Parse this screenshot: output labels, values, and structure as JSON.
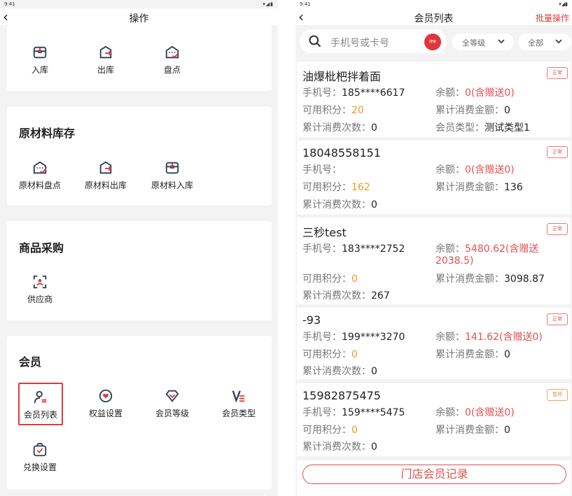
{
  "left": {
    "statusbar": {
      "time": "9:41",
      "icons": "▾◢▮"
    },
    "header": {
      "back": "‹",
      "title": "操作"
    },
    "top_section": {
      "items": [
        {
          "label": "入库",
          "icon": "inbox-in-icon"
        },
        {
          "label": "出库",
          "icon": "box-out-icon"
        },
        {
          "label": "盘点",
          "icon": "stocktake-icon"
        }
      ]
    },
    "raw_material": {
      "title": "原材料库存",
      "items": [
        {
          "label": "原材料盘点",
          "icon": "stocktake-icon"
        },
        {
          "label": "原材料出库",
          "icon": "box-out-icon"
        },
        {
          "label": "原材料入库",
          "icon": "inbox-in-icon"
        }
      ]
    },
    "purchase": {
      "title": "商品采购",
      "items": [
        {
          "label": "供应商",
          "icon": "supplier-icon"
        }
      ]
    },
    "member": {
      "title": "会员",
      "items": [
        {
          "label": "会员列表",
          "icon": "member-list-icon"
        },
        {
          "label": "权益设置",
          "icon": "benefits-icon"
        },
        {
          "label": "会员等级",
          "icon": "diamond-icon"
        },
        {
          "label": "会员类型",
          "icon": "member-type-icon"
        },
        {
          "label": "兑换设置",
          "icon": "redeem-icon"
        }
      ]
    }
  },
  "right": {
    "statusbar": {
      "time": "9:41",
      "icons": "▾◢▮"
    },
    "header": {
      "back": "‹",
      "title": "会员列表",
      "batch": "批量操作"
    },
    "search": {
      "placeholder": "手机号或卡号",
      "button": "搜索"
    },
    "filters": {
      "level": "全等级",
      "status": "全部"
    },
    "labels": {
      "phone": "手机号：",
      "balance": "余额：",
      "points": "可用积分：",
      "total_amount": "累计消费金额：",
      "total_count": "累计消费次数：",
      "member_type": "会员类型："
    },
    "members": [
      {
        "name": "油爆枇杷拌着面",
        "status": "正常",
        "phone": "185****6617",
        "balance": "0(含赠送0)",
        "points": "20",
        "total_amount": "0",
        "total_count": "0",
        "member_type": "测试类型1"
      },
      {
        "name": "18048558151",
        "status": "正常",
        "phone": "",
        "balance": "0(含赠送0)",
        "points": "162",
        "total_amount": "136",
        "total_count": "0"
      },
      {
        "name": "三秒test",
        "status": "正常",
        "phone": "183****2752",
        "balance": "5480.62(含赠送2038.5)",
        "points": "0",
        "total_amount": "3098.87",
        "total_count": "267"
      },
      {
        "name": "-93",
        "status": "正常",
        "phone": "199****3270",
        "balance": "141.62(含赠送0)",
        "points": "0",
        "total_amount": "0",
        "total_count": "0"
      },
      {
        "name": "15982875475",
        "status": "暂停",
        "phone": "159****5475",
        "balance": "0(含赠送0)",
        "points": "0",
        "total_amount": "0",
        "total_count": "0"
      }
    ],
    "bottom_button": "门店会员记录"
  },
  "colors": {
    "accent": "#e03a3a",
    "icon_dark": "#2d3e50",
    "orange": "#ef9a2a"
  }
}
